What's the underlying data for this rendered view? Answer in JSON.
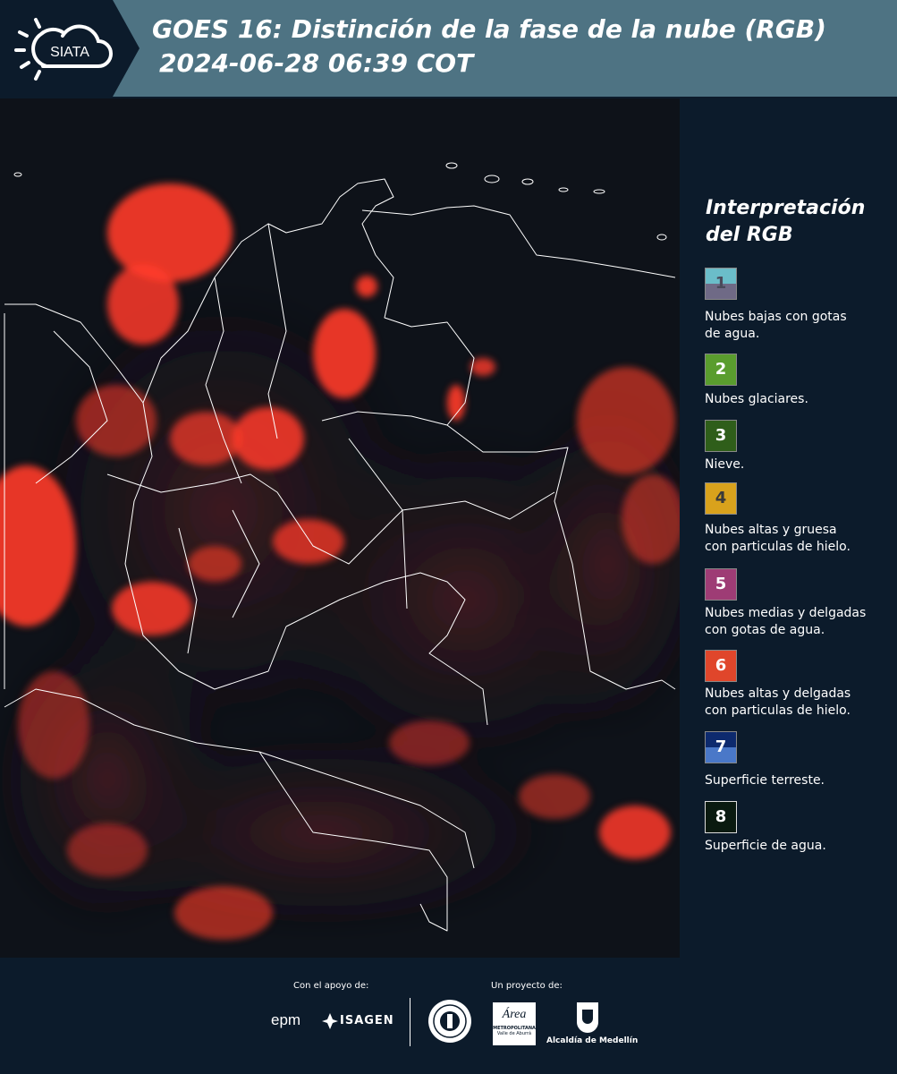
{
  "header": {
    "brand": "SIATA",
    "title_line1": "GOES 16: Distinción de la fase de la nube (RGB)",
    "title_line2": "2024-06-28 06:39 COT"
  },
  "legend": {
    "title_line1": "Interpretación",
    "title_line2": "del RGB",
    "items": [
      {
        "number": "1",
        "color_top": "#6bbdc9",
        "color_bottom": "#6f6a86",
        "text_color": "#4a4a5a",
        "line1": "Nubes bajas con gotas",
        "line2": "de agua."
      },
      {
        "number": "2",
        "color_top": "#5a9d2e",
        "color_bottom": "#5a9d2e",
        "text_color": "#ffffff",
        "line1": "Nubes glaciares.",
        "line2": ""
      },
      {
        "number": "3",
        "color_top": "#2f5e1a",
        "color_bottom": "#2f5e1a",
        "text_color": "#ffffff",
        "line1": "Nieve.",
        "line2": ""
      },
      {
        "number": "4",
        "color_top": "#d9a21c",
        "color_bottom": "#d9a21c",
        "text_color": "#3a3a3a",
        "line1": "Nubes altas y gruesa",
        "line2": "con particulas de hielo."
      },
      {
        "number": "5",
        "color_top": "#9e3c75",
        "color_bottom": "#9e3c75",
        "text_color": "#ffffff",
        "line1": "Nubes medias y delgadas",
        "line2": "con gotas de agua."
      },
      {
        "number": "6",
        "color_top": "#e0462b",
        "color_bottom": "#e0462b",
        "text_color": "#ffffff",
        "line1": "Nubes altas y delgadas",
        "line2": "con particulas de hielo."
      },
      {
        "number": "7",
        "color_top": "#0d2a6e",
        "color_bottom": "#4a78c8",
        "text_color": "#ffffff",
        "line1": "Superficie terreste.",
        "line2": ""
      },
      {
        "number": "8",
        "color_top": "#0a1a10",
        "color_bottom": "#0a1a10",
        "text_color": "#ffffff",
        "line1": "Superficie de agua.",
        "line2": ""
      }
    ]
  },
  "footer": {
    "support_label": "Con el apoyo de:",
    "project_label": "Un proyecto de:",
    "sponsor1": "epm",
    "sponsor2": "ISAGEN",
    "partner_area_1": "Área",
    "partner_area_2": "METROPOLITANA",
    "partner_area_3": "Valle de Aburrá",
    "partner_alcaldia": "Alcaldía de Medellín"
  },
  "colors": {
    "header_bg": "#4e7383",
    "logo_bg": "#0c1b2b",
    "panel_bg": "#0c1b2b",
    "cloud_red": "#ff3b2a",
    "border_white": "#ffffff"
  },
  "icons": [
    "sun-cloud-logo-icon",
    "epm-logo-icon",
    "isagen-logo-icon",
    "university-seal-icon",
    "area-metropolitana-logo-icon",
    "alcaldia-shield-icon"
  ]
}
